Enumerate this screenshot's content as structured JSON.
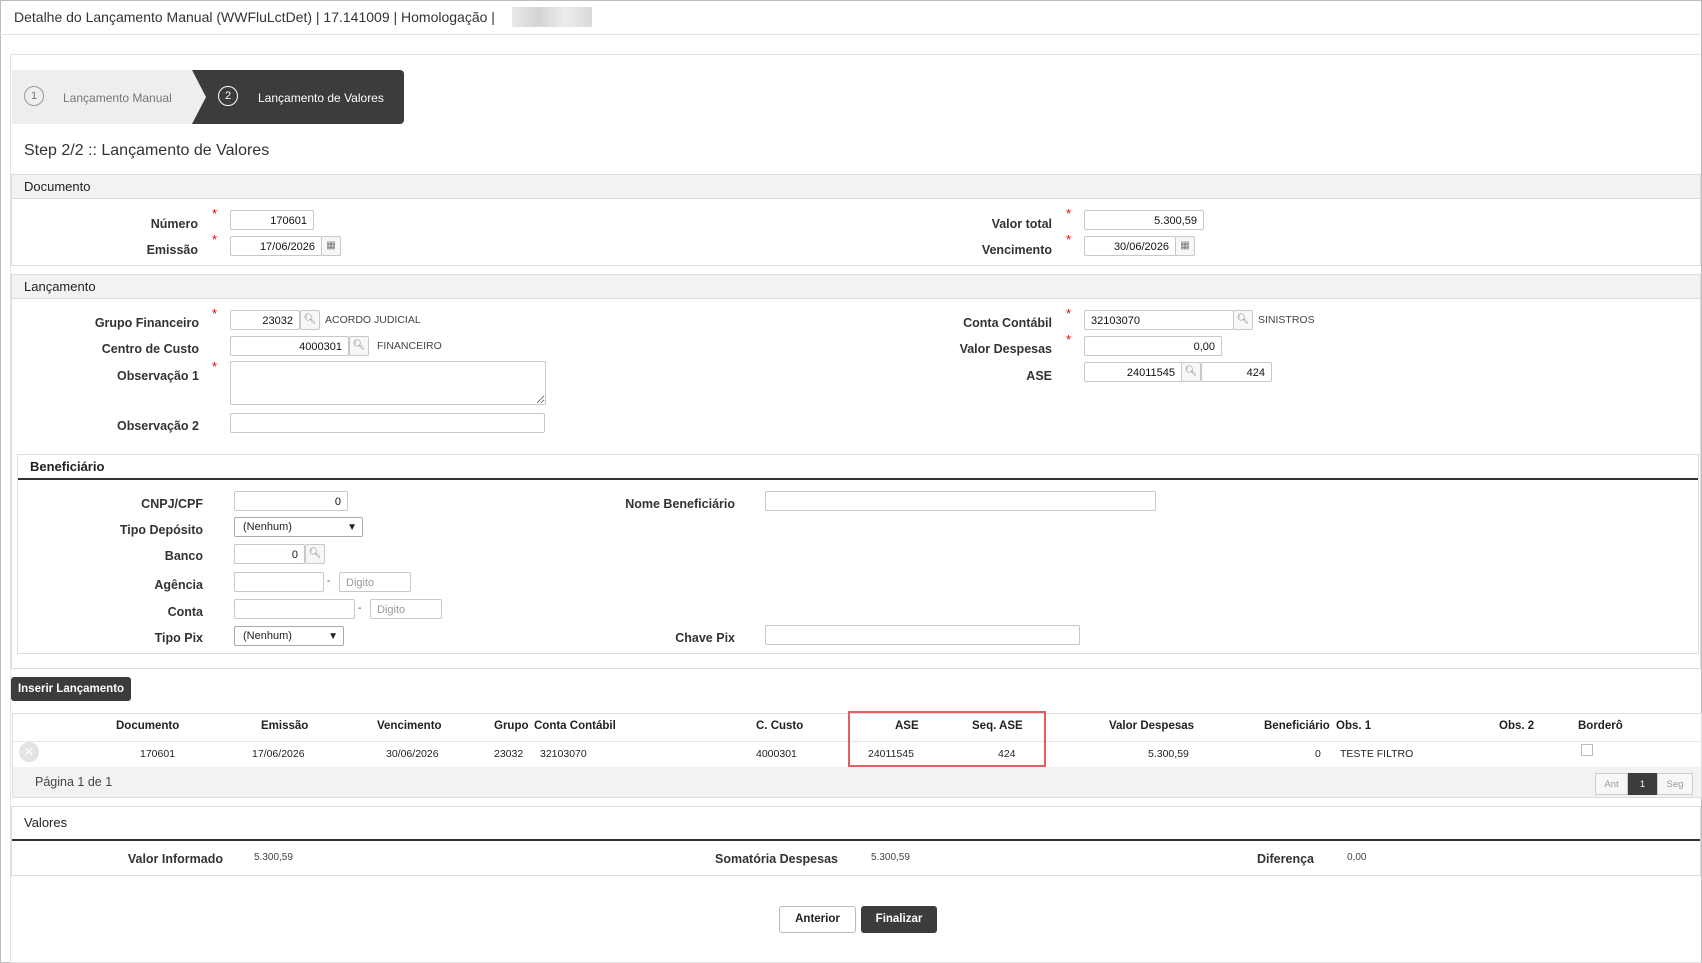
{
  "window": {
    "title": "Detalhe do Lançamento Manual (WWFluLctDet) | 17.141009 | Homologação |"
  },
  "wizard": {
    "steps": [
      {
        "number": "1",
        "label": "Lançamento Manual"
      },
      {
        "number": "2",
        "label": "Lançamento de Valores"
      }
    ],
    "heading": "Step 2/2 :: Lançamento de Valores"
  },
  "documento": {
    "title": "Documento",
    "numero_label": "Número",
    "numero": "170601",
    "emissao_label": "Emissão",
    "emissao": "17/06/2026",
    "valor_total_label": "Valor total",
    "valor_total": "5.300,59",
    "vencimento_label": "Vencimento",
    "vencimento": "30/06/2026"
  },
  "lancamento": {
    "title": "Lançamento",
    "grupo_label": "Grupo Financeiro",
    "grupo": "23032",
    "grupo_desc": "ACORDO JUDICIAL",
    "centro_label": "Centro de Custo",
    "centro": "4000301",
    "centro_desc": "FINANCEIRO",
    "obs1_label": "Observação 1",
    "obs1": "",
    "obs2_label": "Observação 2",
    "obs2": "",
    "conta_label": "Conta Contábil",
    "conta": "32103070",
    "conta_desc": "SINISTROS",
    "valor_desp_label": "Valor Despesas",
    "valor_desp": "0,00",
    "ase_label": "ASE",
    "ase": "24011545",
    "ase_seq": "424"
  },
  "beneficiario": {
    "title": "Beneficiário",
    "cnpj_label": "CNPJ/CPF",
    "cnpj": "0",
    "tipo_dep_label": "Tipo Depósito",
    "tipo_dep": "(Nenhum)",
    "banco_label": "Banco",
    "banco": "0",
    "agencia_label": "Agência",
    "agencia": "",
    "digito_placeholder": "Digito",
    "conta_label": "Conta",
    "conta": "",
    "tipo_pix_label": "Tipo Pix",
    "tipo_pix": "(Nenhum)",
    "nome_label": "Nome Beneficiário",
    "nome": "",
    "chave_label": "Chave Pix",
    "chave": "",
    "dash": "-"
  },
  "buttons": {
    "inserir": "Inserir Lançamento",
    "anterior": "Anterior",
    "finalizar": "Finalizar"
  },
  "grid": {
    "headers": [
      "Documento",
      "Emissão",
      "Vencimento",
      "Grupo",
      "Conta Contábil",
      "C. Custo",
      "ASE",
      "Seq. ASE",
      "Valor Despesas",
      "Beneficiário",
      "Obs. 1",
      "Obs. 2",
      "Borderô"
    ],
    "row": {
      "documento": "170601",
      "emissao": "17/06/2026",
      "vencimento": "30/06/2026",
      "grupo": "23032",
      "conta": "32103070",
      "custo": "4000301",
      "ase": "24011545",
      "seq": "424",
      "valor": "5.300,59",
      "beneficiario": "0",
      "obs1": "TESTE FILTRO",
      "obs2": "",
      "bordero": false
    },
    "pager": {
      "text": "Página 1 de 1",
      "prev": "Ant",
      "page": "1",
      "next": "Seg"
    }
  },
  "valores": {
    "title": "Valores",
    "informado_label": "Valor Informado",
    "informado": "5.300,59",
    "somatoria_label": "Somatória Despesas",
    "somatoria": "5.300,59",
    "diferenca_label": "Diferença",
    "diferenca": "0,00"
  },
  "icons": {
    "search": "search-icon",
    "calendar": "calendar-icon",
    "remove": "remove-row-icon"
  },
  "colors": {
    "dark": "#3c3c3c",
    "required": "#e00000",
    "highlight": "#e06060"
  }
}
